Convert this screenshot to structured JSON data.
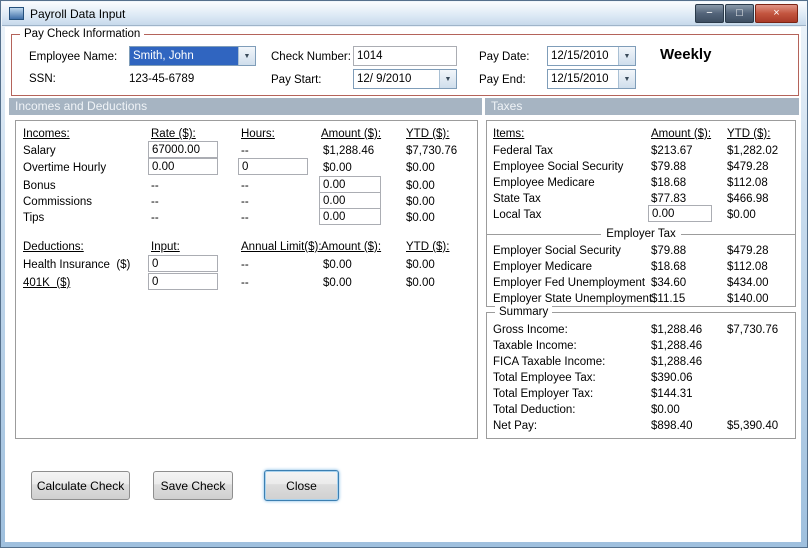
{
  "window": {
    "title": "Payroll Data Input"
  },
  "icons": {
    "dropdown_arrow": "▼",
    "minimize": "−",
    "maximize": "□",
    "close": "×"
  },
  "paycheck": {
    "legend": "Pay Check Information",
    "employee_label": "Employee Name:",
    "employee_value": "Smith, John",
    "ssn_label": "SSN:",
    "ssn_value": "123-45-6789",
    "check_number_label": "Check Number:",
    "check_number_value": "1014",
    "pay_start_label": "Pay Start:",
    "pay_start_value": "12/ 9/2010",
    "pay_date_label": "Pay Date:",
    "pay_date_value": "12/15/2010",
    "pay_end_label": "Pay End:",
    "pay_end_value": "12/15/2010",
    "frequency": "Weekly"
  },
  "incomes_panel": {
    "header": "Incomes and Deductions",
    "incomes": {
      "headers": {
        "name": "Incomes:",
        "rate": "Rate ($):",
        "hours": "Hours:",
        "amount": "Amount ($):",
        "ytd": "YTD ($):"
      },
      "rows": [
        {
          "name": "Salary",
          "rate": "67000.00",
          "hours": "--",
          "amount": "$1,288.46",
          "ytd": "$7,730.76"
        },
        {
          "name": "Overtime Hourly",
          "rate": "0.00",
          "hours": "0",
          "amount": "$0.00",
          "ytd": "$0.00"
        },
        {
          "name": "Bonus",
          "rate": "--",
          "hours": "--",
          "amount": "0.00",
          "ytd": "$0.00"
        },
        {
          "name": "Commissions",
          "rate": "--",
          "hours": "--",
          "amount": "0.00",
          "ytd": "$0.00"
        },
        {
          "name": "Tips",
          "rate": "--",
          "hours": "--",
          "amount": "0.00",
          "ytd": "$0.00"
        }
      ]
    },
    "deductions": {
      "headers": {
        "name": "Deductions:",
        "input": "Input:",
        "limit": "Annual Limit($):",
        "amount": "Amount ($):",
        "ytd": "YTD ($):"
      },
      "rows": [
        {
          "name": "Health Insurance  ($)",
          "input": "0",
          "limit": "--",
          "amount": "$0.00",
          "ytd": "$0.00"
        },
        {
          "name": "401K  ($)",
          "input": "0",
          "limit": "--",
          "amount": "$0.00",
          "ytd": "$0.00"
        }
      ]
    }
  },
  "taxes_panel": {
    "header": "Taxes",
    "headers": {
      "items": "Items:",
      "amount": "Amount ($):",
      "ytd": "YTD ($):"
    },
    "employee_rows": [
      {
        "name": "Federal Tax",
        "amount": "$213.67",
        "ytd": "$1,282.02"
      },
      {
        "name": "Employee Social Security",
        "amount": "$79.88",
        "ytd": "$479.28"
      },
      {
        "name": "Employee Medicare",
        "amount": "$18.68",
        "ytd": "$112.08"
      },
      {
        "name": "State Tax",
        "amount": "$77.83",
        "ytd": "$466.98"
      },
      {
        "name": "Local Tax",
        "amount": "0.00",
        "ytd": "$0.00"
      }
    ],
    "employer_header": "Employer Tax",
    "employer_rows": [
      {
        "name": "Employer Social Security",
        "amount": "$79.88",
        "ytd": "$479.28"
      },
      {
        "name": "Employer Medicare",
        "amount": "$18.68",
        "ytd": "$112.08"
      },
      {
        "name": "Employer Fed Unemployment",
        "amount": "$34.60",
        "ytd": "$434.00"
      },
      {
        "name": "Employer State Unemployment",
        "amount": "$11.15",
        "ytd": "$140.00"
      }
    ]
  },
  "summary_panel": {
    "legend": "Summary",
    "rows": [
      {
        "name": "Gross Income:",
        "amount": "$1,288.46",
        "ytd": "$7,730.76"
      },
      {
        "name": "Taxable Income:",
        "amount": "$1,288.46",
        "ytd": ""
      },
      {
        "name": "FICA Taxable Income:",
        "amount": "$1,288.46",
        "ytd": ""
      },
      {
        "name": "Total Employee Tax:",
        "amount": "$390.06",
        "ytd": ""
      },
      {
        "name": "Total Employer Tax:",
        "amount": "$144.31",
        "ytd": ""
      },
      {
        "name": "Total Deduction:",
        "amount": "$0.00",
        "ytd": ""
      },
      {
        "name": "Net Pay:",
        "amount": "$898.40",
        "ytd": "$5,390.40"
      }
    ]
  },
  "buttons": {
    "calculate": "Calculate Check",
    "save": "Save Check",
    "close": "Close"
  }
}
